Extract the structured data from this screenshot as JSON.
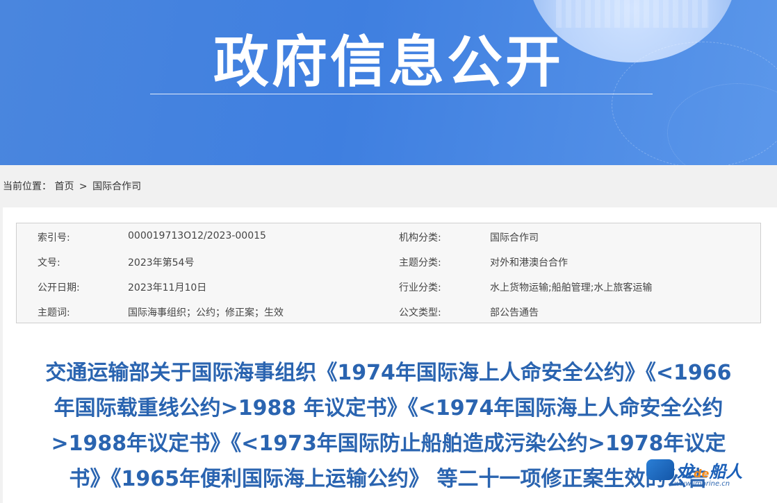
{
  "banner": {
    "title": "政府信息公开"
  },
  "breadcrumb": {
    "label": "当前位置：",
    "home": "首页",
    "sep": ">",
    "current": "国际合作司"
  },
  "meta": {
    "rows": [
      {
        "k1": "索引号:",
        "v1": "000019713O12/2023-00015",
        "k2": "机构分类:",
        "v2": "国际合作司"
      },
      {
        "k1": "文号:",
        "v1": "2023年第54号",
        "k2": "主题分类:",
        "v2": "对外和港澳台合作"
      },
      {
        "k1": "公开日期:",
        "v1": "2023年11月10日",
        "k2": "行业分类:",
        "v2": "水上货物运输;船舶管理;水上旅客运输"
      },
      {
        "k1": "主题词:",
        "v1": "国际海事组织；公约；修正案；生效",
        "k2": "公文类型:",
        "v2": "部公告通告"
      }
    ]
  },
  "document": {
    "title_lines": [
      "交通运输部关于国际海事组织《1974年国际海上人命安全公约》《<1966",
      "年国际载重线公约>1988 年议定书》《<1974年国际海上人命安全公约",
      ">1988年议定书》《<1973年国际防止船舶造成污染公约>1978年议定",
      "书》《1965年便利国际海上运输公约》 等二十一项修正案生效的公告"
    ]
  },
  "watermark": {
    "brand_a": "龙",
    "brand_de": "de",
    "brand_b": "船人",
    "url": "www.imarine.cn"
  }
}
